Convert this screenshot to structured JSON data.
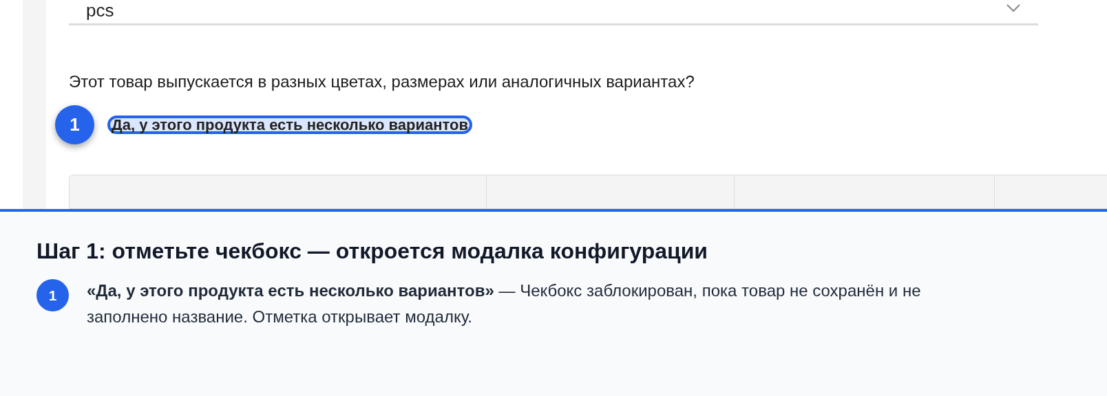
{
  "form": {
    "unit_select": {
      "value": "pcs"
    },
    "question": "Этот товар выпускается в разных цветах, размерах или аналогичных вариантах?",
    "variants_option": {
      "label": "Да, у этого продукта есть несколько вариантов",
      "marker": "1"
    }
  },
  "guide": {
    "title": "Шаг 1: отметьте чекбокс — откроется модалка конфигурации",
    "items": [
      {
        "marker": "1",
        "text": "**«Да, у этого продукта есть несколько вариантов»** — Чекбокс заблокирован, пока товар не сохранён и не заполнено название. Отметка открывает модалку."
      }
    ]
  }
}
